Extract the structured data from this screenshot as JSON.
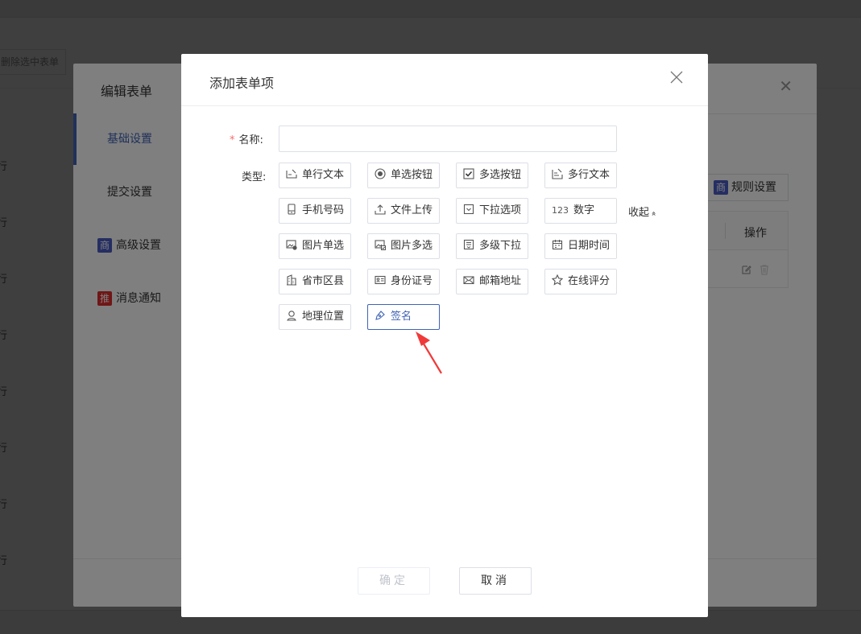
{
  "background": {
    "delete_selected_label": "删除选中表单",
    "row_label": "行"
  },
  "edit_dialog": {
    "title": "编辑表单",
    "close_glyph": "✕",
    "sidebar": [
      {
        "label": "基础设置",
        "active": true
      },
      {
        "label": "提交设置",
        "active": false
      },
      {
        "label": "高级设置",
        "badge": "商",
        "badge_color": "#4b5cc4"
      },
      {
        "label": "消息通知",
        "badge": "推",
        "badge_color": "#e02d2d"
      }
    ],
    "rule_button": {
      "label": "规则设置",
      "badge": "商",
      "badge_color": "#4b5cc4"
    },
    "table": {
      "operation_header": "操作"
    }
  },
  "modal": {
    "title": "添加表单项",
    "name_label": "名称:",
    "name_value": "",
    "required_mark": "*",
    "type_label": "类型:",
    "types": [
      {
        "label": "单行文本",
        "icon": "single-line-text-icon"
      },
      {
        "label": "单选按钮",
        "icon": "radio-icon"
      },
      {
        "label": "多选按钮",
        "icon": "checkbox-icon"
      },
      {
        "label": "多行文本",
        "icon": "multi-line-text-icon"
      },
      {
        "label": "手机号码",
        "icon": "mobile-phone-icon"
      },
      {
        "label": "文件上传",
        "icon": "upload-icon"
      },
      {
        "label": "下拉选项",
        "icon": "dropdown-icon"
      },
      {
        "label": "数字",
        "icon": "number-icon",
        "prefix": "123"
      },
      {
        "label": "图片单选",
        "icon": "image-single-icon"
      },
      {
        "label": "图片多选",
        "icon": "image-multi-icon"
      },
      {
        "label": "多级下拉",
        "icon": "multi-level-dropdown-icon"
      },
      {
        "label": "日期时间",
        "icon": "calendar-icon"
      },
      {
        "label": "省市区县",
        "icon": "building-icon"
      },
      {
        "label": "身份证号",
        "icon": "id-card-icon"
      },
      {
        "label": "邮箱地址",
        "icon": "mail-icon"
      },
      {
        "label": "在线评分",
        "icon": "star-icon"
      },
      {
        "label": "地理位置",
        "icon": "location-person-icon"
      },
      {
        "label": "签名",
        "icon": "signature-icon",
        "selected": true
      }
    ],
    "collapse_label": "收起",
    "collapse_glyph": "»",
    "confirm_label": "确定",
    "cancel_label": "取消"
  },
  "colors": {
    "accent": "#3f63b5",
    "required": "#f56c6c",
    "arrow": "#f03a3a"
  }
}
